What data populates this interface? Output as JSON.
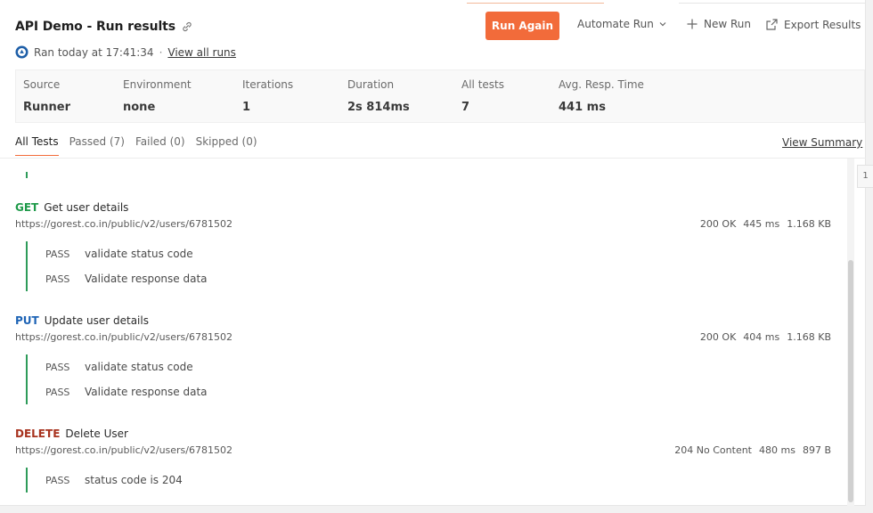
{
  "header": {
    "title": "API Demo - Run results",
    "ran_text": "Ran today at 17:41:34",
    "separator": "·",
    "view_all_runs": "View all runs"
  },
  "actions": {
    "run_again": "Run Again",
    "automate_run": "Automate Run",
    "new_run": "New Run",
    "export_results": "Export Results"
  },
  "summary": [
    {
      "label": "Source",
      "value": "Runner"
    },
    {
      "label": "Environment",
      "value": "none"
    },
    {
      "label": "Iterations",
      "value": "1"
    },
    {
      "label": "Duration",
      "value": "2s 814ms"
    },
    {
      "label": "All tests",
      "value": "7"
    },
    {
      "label": "Avg. Resp. Time",
      "value": "441 ms"
    }
  ],
  "tabs": [
    {
      "label": "All Tests"
    },
    {
      "label": "Passed (7)"
    },
    {
      "label": "Failed (0)"
    },
    {
      "label": "Skipped (0)"
    }
  ],
  "view_summary": "View Summary",
  "side_indicator": "1",
  "requests": [
    {
      "method": "GET",
      "name": "Get user details",
      "url": "https://gorest.co.in/public/v2/users/6781502",
      "status": "200 OK",
      "time": "445 ms",
      "size": "1.168 KB",
      "tests": [
        {
          "status": "PASS",
          "name": "validate status code"
        },
        {
          "status": "PASS",
          "name": "Validate response data"
        }
      ]
    },
    {
      "method": "PUT",
      "name": "Update user details",
      "url": "https://gorest.co.in/public/v2/users/6781502",
      "status": "200 OK",
      "time": "404 ms",
      "size": "1.168 KB",
      "tests": [
        {
          "status": "PASS",
          "name": "validate status code"
        },
        {
          "status": "PASS",
          "name": "Validate response data"
        }
      ]
    },
    {
      "method": "DELETE",
      "name": "Delete User",
      "url": "https://gorest.co.in/public/v2/users/6781502",
      "status": "204 No Content",
      "time": "480 ms",
      "size": "897 B",
      "tests": [
        {
          "status": "PASS",
          "name": "status code is 204"
        }
      ]
    }
  ],
  "colors": {
    "accent": "#f26b3a",
    "get": "#1f9a4a",
    "put": "#1d63b5",
    "delete": "#a8331f",
    "pass_bar": "#2e9b5a"
  }
}
